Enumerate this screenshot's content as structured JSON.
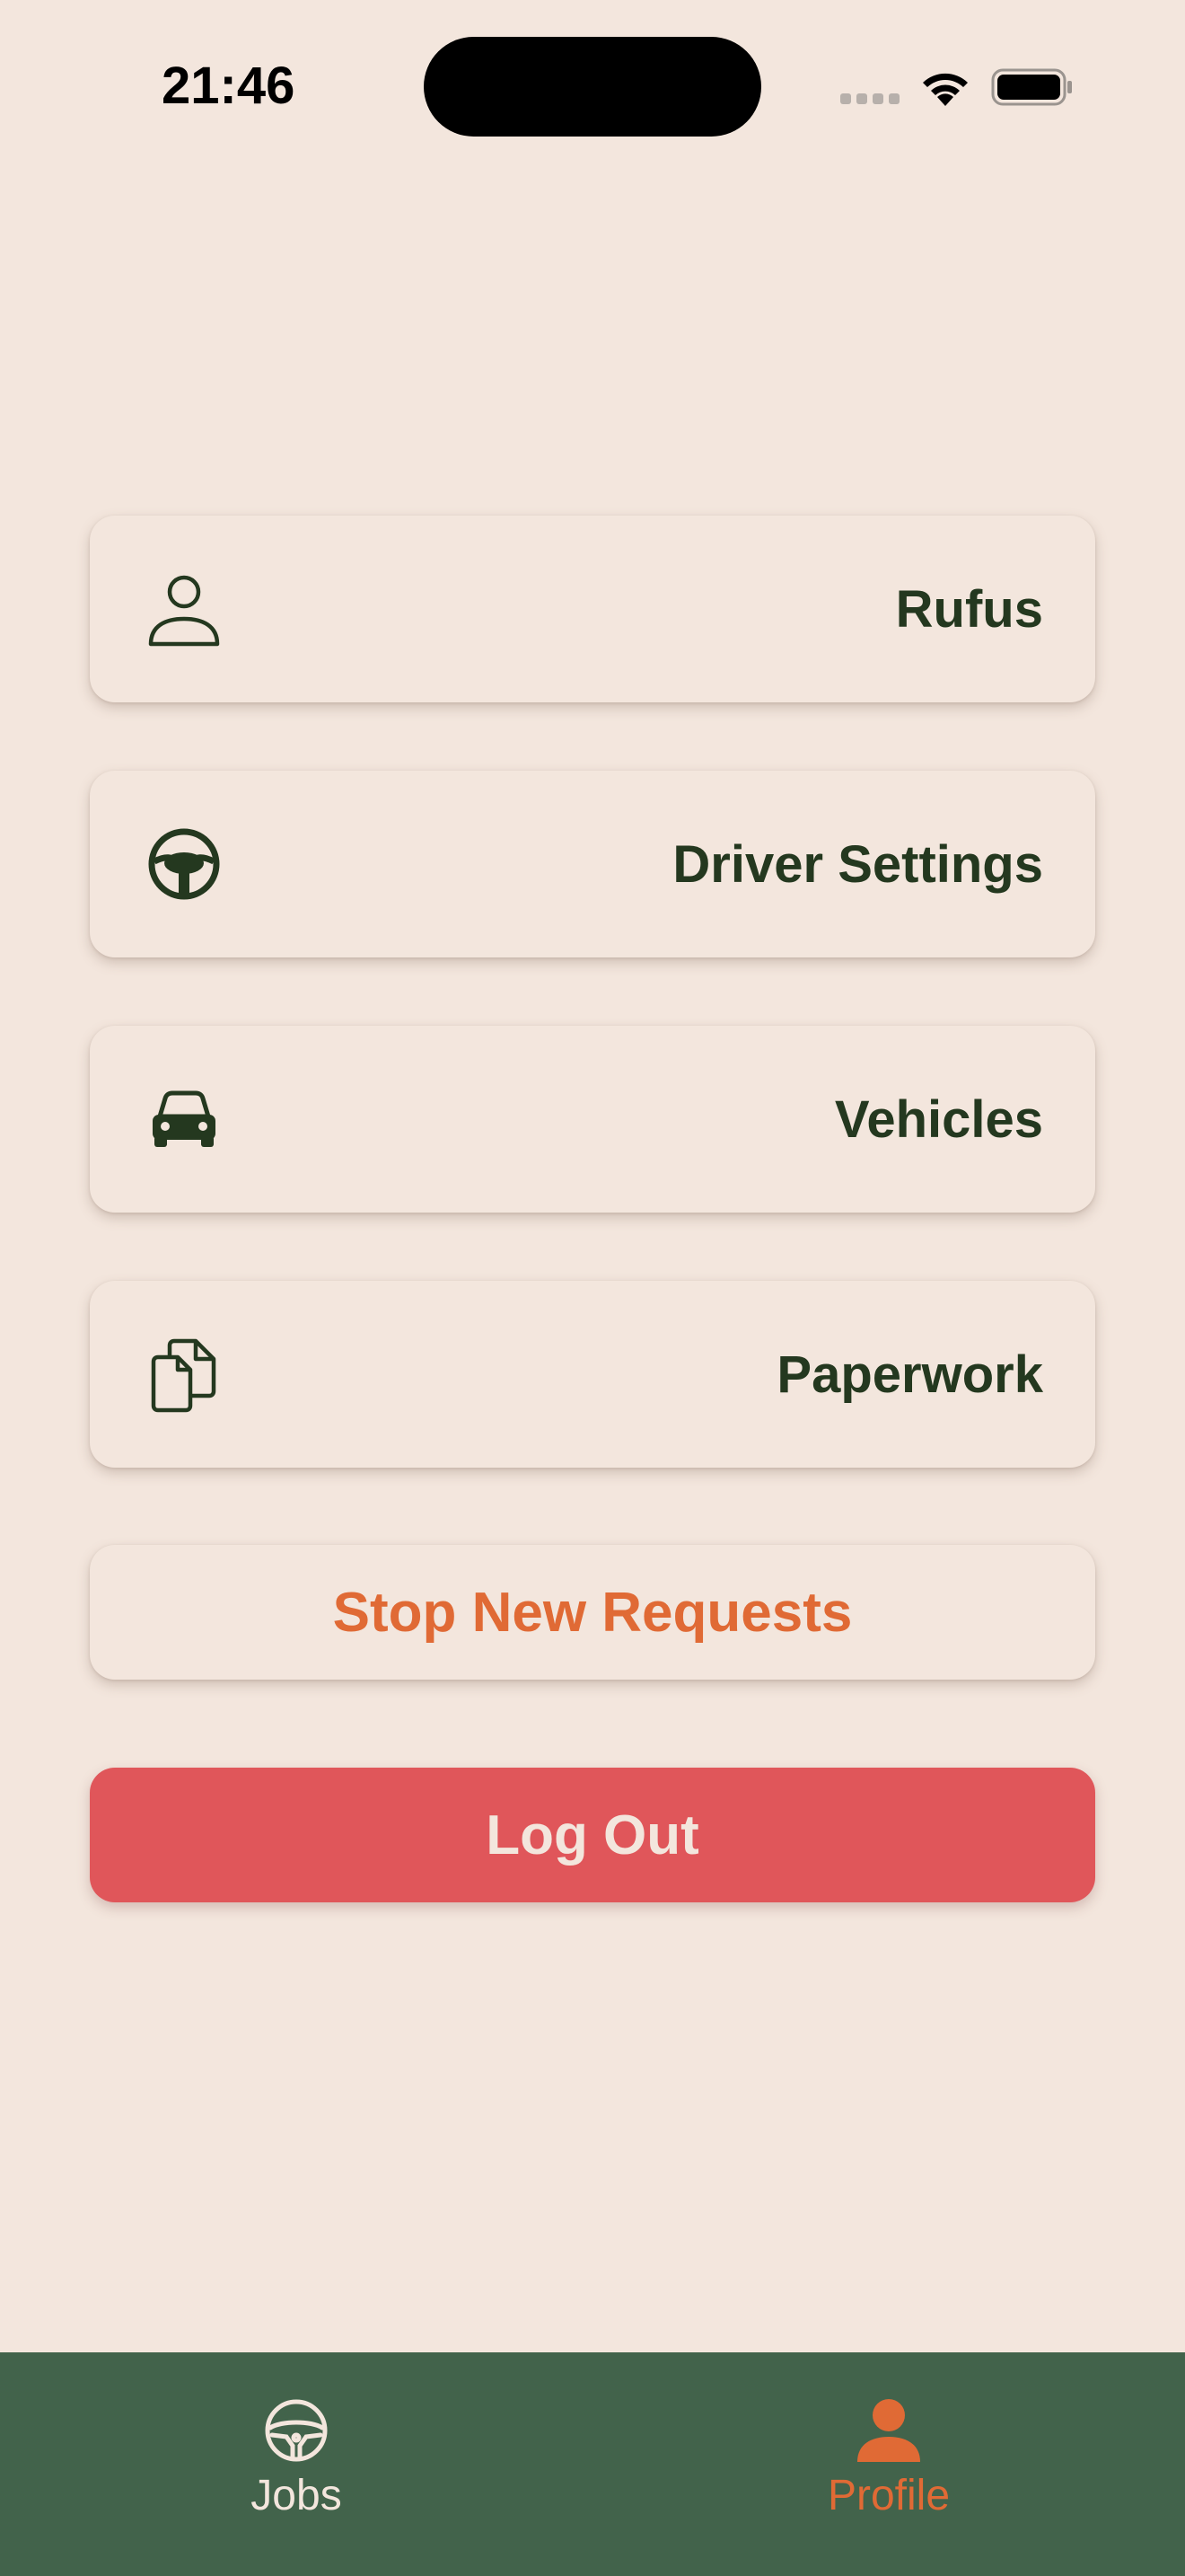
{
  "status_bar": {
    "time": "21:46"
  },
  "menu": {
    "items": [
      {
        "label": "Rufus",
        "icon": "person-icon"
      },
      {
        "label": "Driver Settings",
        "icon": "steering-wheel-icon"
      },
      {
        "label": "Vehicles",
        "icon": "car-icon"
      },
      {
        "label": "Paperwork",
        "icon": "documents-icon"
      }
    ]
  },
  "actions": {
    "stop_label": "Stop New Requests",
    "logout_label": "Log Out"
  },
  "tabbar": {
    "tabs": [
      {
        "label": "Jobs",
        "icon": "steering-wheel-icon",
        "active": false
      },
      {
        "label": "Profile",
        "icon": "person-icon",
        "active": true
      }
    ]
  },
  "colors": {
    "background": "#f3e6dd",
    "text": "#24381f",
    "accent": "#e06a35",
    "danger": "#e0565a",
    "tabbar": "#42634b"
  }
}
